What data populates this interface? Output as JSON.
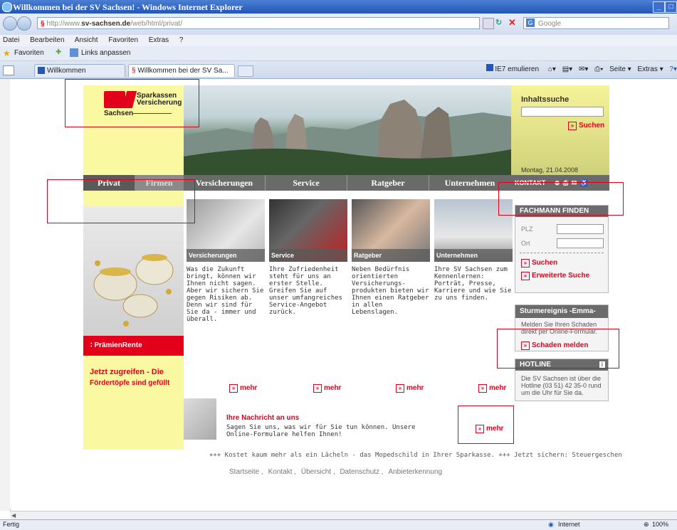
{
  "window": {
    "title": "Willkommen bei der SV Sachsen! - Windows Internet Explorer"
  },
  "address": {
    "prefix": "http://www.",
    "domain": "sv-sachsen.de",
    "path": "/web/html/privat/"
  },
  "search_engine": "Google",
  "menu": [
    "Datei",
    "Bearbeiten",
    "Ansicht",
    "Favoriten",
    "Extras",
    "?"
  ],
  "favbar": {
    "favorites": "Favoriten",
    "links": "Links anpassen"
  },
  "tabs": [
    {
      "label": "Willkommen"
    },
    {
      "label": "Willkommen bei der SV Sa..."
    }
  ],
  "cmdbar": {
    "emulate": "IE7 emulieren",
    "page": "Seite",
    "extras": "Extras"
  },
  "logo": {
    "line1": "Sparkassen",
    "line2": "Versicherung",
    "region": "Sachsen"
  },
  "inhaltssuche": {
    "title": "Inhaltssuche",
    "button": "Suchen",
    "date": "Montag, 21.04.2008"
  },
  "nav": [
    "Privat",
    "Firmen",
    "Versicherungen",
    "Service",
    "Ratgeber",
    "Unternehmen"
  ],
  "kontakt": "KONTAKT",
  "promo": {
    "label": "PrämienRente",
    "headline": "Jetzt zugreifen - Die",
    "sub": "Fördertöpfe sind gefüllt"
  },
  "columns": [
    {
      "caption": "Versicherungen",
      "text": "Was die Zukunft bringt, können wir Ihnen nicht sagen. Aber wir sichern Sie gegen Risiken ab. Denn wir sind für Sie da - immer und überall.",
      "more": "mehr"
    },
    {
      "caption": "Service",
      "text": "Ihre Zufriedenheit steht für uns an erster Stelle. Greifen Sie auf unser umfangreiches Service-Angebot zurück.",
      "more": "mehr"
    },
    {
      "caption": "Ratgeber",
      "text": "Neben Bedürfnis orientierten Versicherungs-produkten bieten wir Ihnen einen Ratgeber in allen Lebenslagen.",
      "more": "mehr"
    },
    {
      "caption": "Unternehmen",
      "text": "Ihre SV Sachsen zum Kennenlernen: Porträt, Presse, Karriere und wie Sie zu uns finden.",
      "more": "mehr"
    }
  ],
  "nachricht": {
    "title": "Ihre Nachricht an uns",
    "text": "Sagen Sie uns, was wir für Sie tun können. Unsere Online-Formulare helfen Ihnen!",
    "more": "mehr"
  },
  "fachmann": {
    "title": "FACHMANN FINDEN",
    "plz": "PLZ",
    "ort": "Ort",
    "search": "Suchen",
    "extended": "Erweiterte Suche"
  },
  "sturm": {
    "title": "Sturmereignis -Emma-",
    "text": "Melden Sie Ihren Schaden direkt per Online-Formular.",
    "link": "Schaden melden"
  },
  "hotline": {
    "title": "HOTLINE",
    "text": "Die SV Sachsen ist über die Hotline (03 51) 42 35-0 rund um die Uhr für Sie da."
  },
  "ticker": "+++ Kostet kaum mehr als ein Lächeln - das Mopedschild in Ihrer Sparkasse. +++ Jetzt sichern: Steuergeschenke vom Staat für I",
  "footer": [
    "Startseite",
    "Kontakt",
    "Übersicht",
    "Datenschutz",
    "Anbieterkennung"
  ],
  "status": {
    "left": "Fertig",
    "zone": "Internet",
    "zoom": "100%"
  },
  "colors": {
    "brand_red": "#e2001a",
    "yellow": "#fbf8a2",
    "nav_gray": "#6a6a6a"
  }
}
